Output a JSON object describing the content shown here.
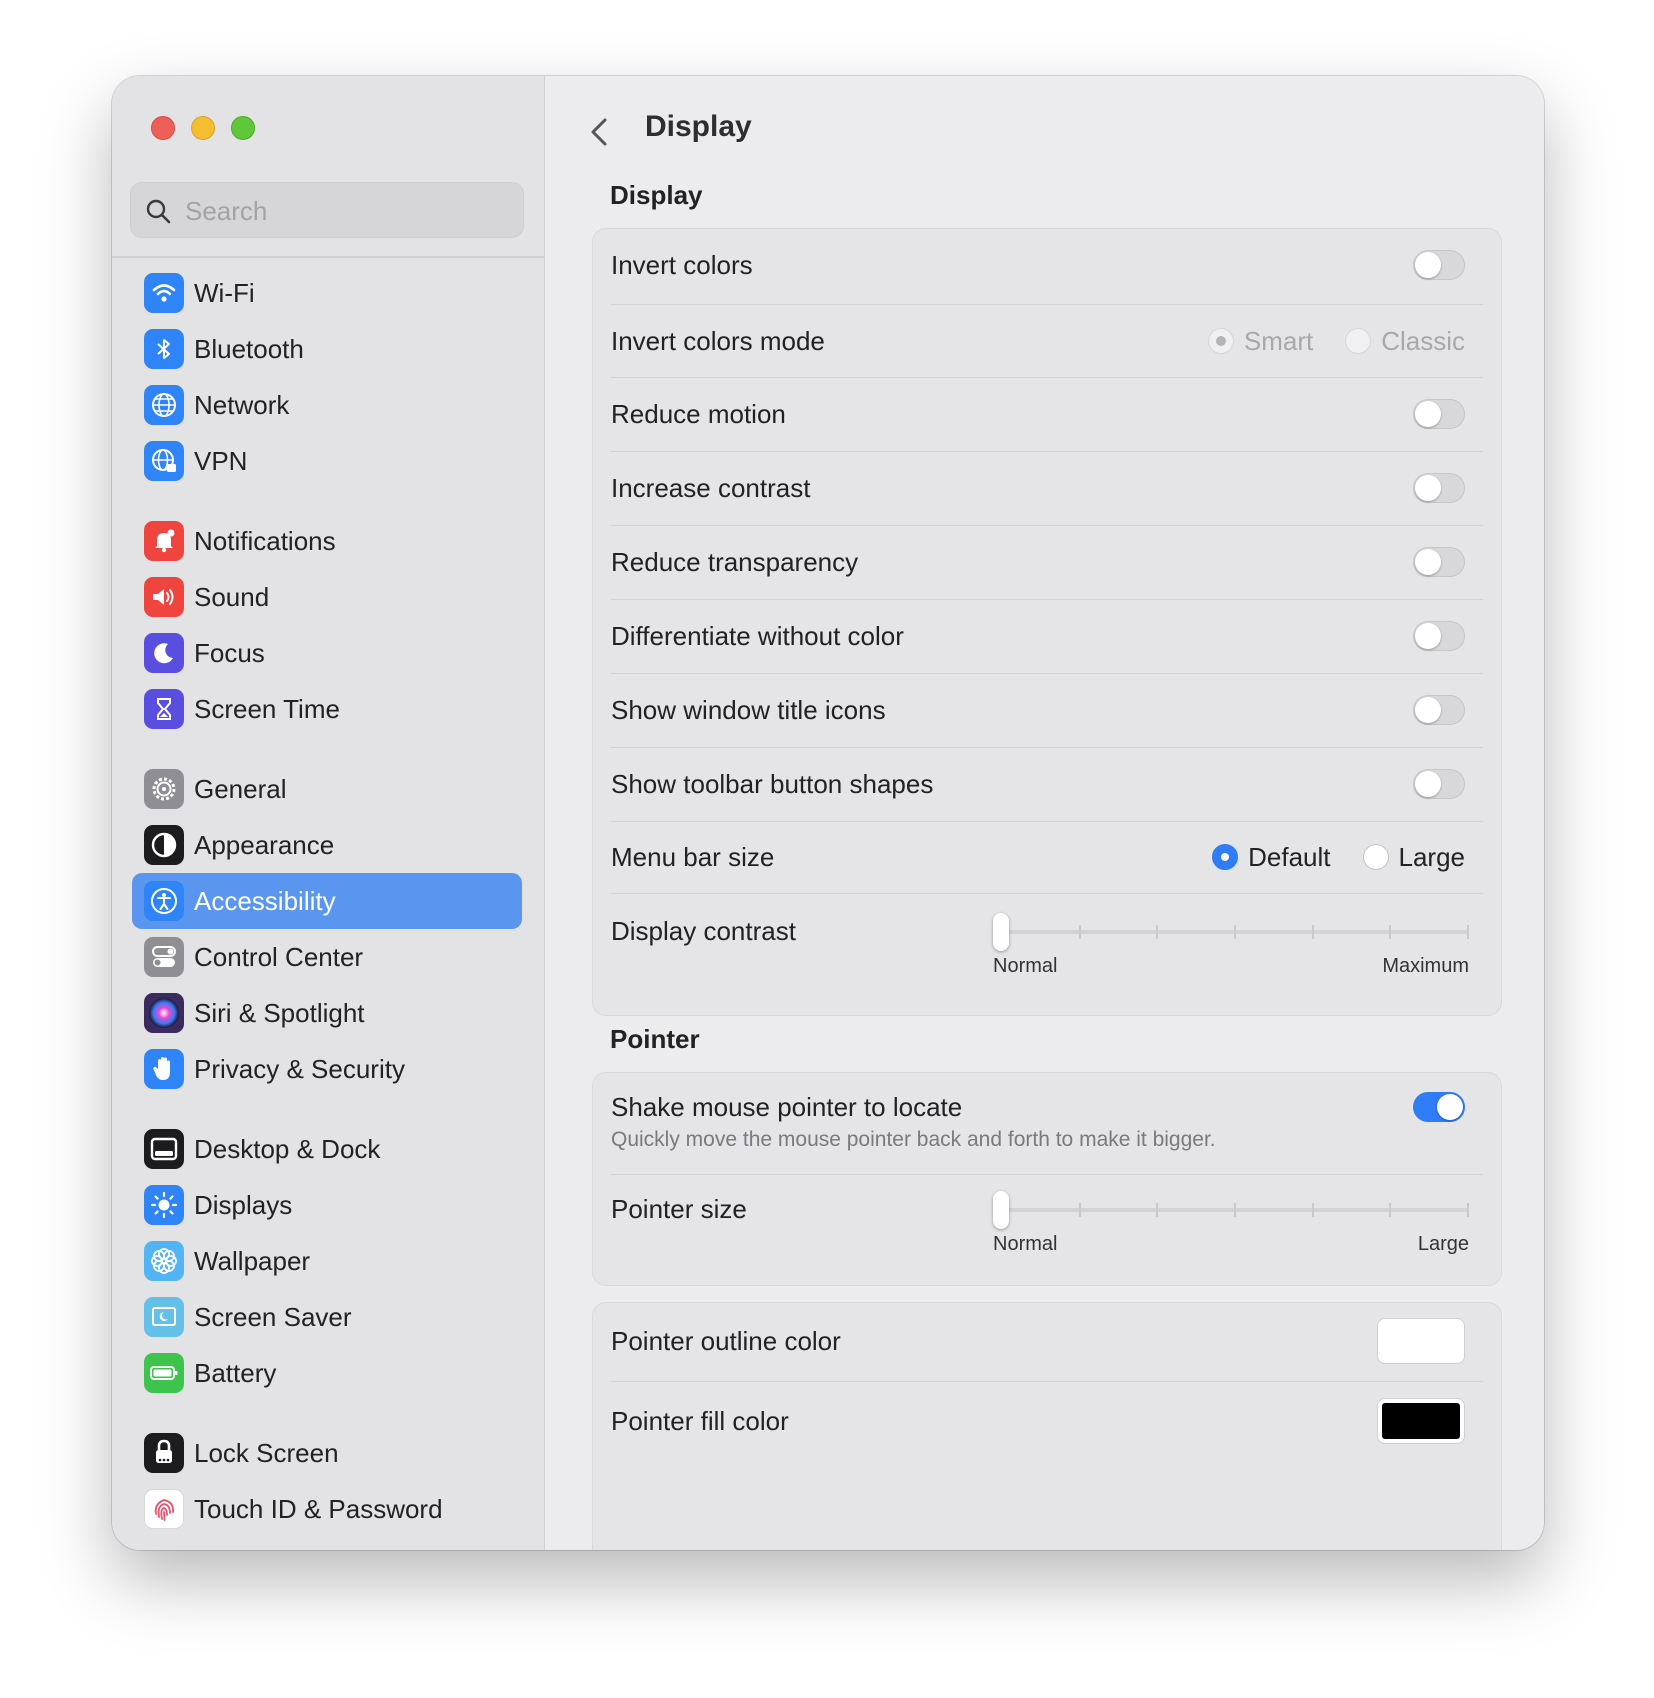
{
  "window": {
    "title": "Display"
  },
  "search": {
    "placeholder": "Search"
  },
  "sidebar": {
    "items": [
      {
        "label": "Wi-Fi",
        "icon": "wifi-icon",
        "color": "#2f84f7"
      },
      {
        "label": "Bluetooth",
        "icon": "bluetooth-icon",
        "color": "#2f84f7"
      },
      {
        "label": "Network",
        "icon": "globe-icon",
        "color": "#2f84f7"
      },
      {
        "label": "VPN",
        "icon": "vpn-globe-icon",
        "color": "#2f84f7"
      },
      {
        "label": "Notifications",
        "icon": "bell-icon",
        "color": "#f0453e"
      },
      {
        "label": "Sound",
        "icon": "speaker-icon",
        "color": "#f0453e"
      },
      {
        "label": "Focus",
        "icon": "moon-icon",
        "color": "#5a4ee0"
      },
      {
        "label": "Screen Time",
        "icon": "hourglass-icon",
        "color": "#5a4ee0"
      },
      {
        "label": "General",
        "icon": "gear-icon",
        "color": "#8e8e93"
      },
      {
        "label": "Appearance",
        "icon": "appearance-icon",
        "color": "#1c1c1e"
      },
      {
        "label": "Accessibility",
        "icon": "accessibility-icon",
        "color": "#2f84f7",
        "selected": true
      },
      {
        "label": "Control Center",
        "icon": "switches-icon",
        "color": "#8e8e93"
      },
      {
        "label": "Siri & Spotlight",
        "icon": "siri-icon",
        "color": "#3a2a5e"
      },
      {
        "label": "Privacy & Security",
        "icon": "hand-icon",
        "color": "#2f84f7"
      },
      {
        "label": "Desktop & Dock",
        "icon": "dock-icon",
        "color": "#1c1c1e"
      },
      {
        "label": "Displays",
        "icon": "sun-icon",
        "color": "#2f84f7"
      },
      {
        "label": "Wallpaper",
        "icon": "flower-icon",
        "color": "#52b4f5"
      },
      {
        "label": "Screen Saver",
        "icon": "screensaver-icon",
        "color": "#64c0e8"
      },
      {
        "label": "Battery",
        "icon": "battery-icon",
        "color": "#3ec44c"
      },
      {
        "label": "Lock Screen",
        "icon": "lock-icon",
        "color": "#1c1c1e"
      },
      {
        "label": "Touch ID & Password",
        "icon": "fingerprint-icon",
        "color": "#ffffff"
      }
    ]
  },
  "display_section": {
    "title": "Display",
    "invert_colors": {
      "label": "Invert colors",
      "on": false
    },
    "invert_mode": {
      "label": "Invert colors mode",
      "options": [
        "Smart",
        "Classic"
      ],
      "selected": "Smart",
      "disabled": true
    },
    "reduce_motion": {
      "label": "Reduce motion",
      "on": false
    },
    "increase_contrast": {
      "label": "Increase contrast",
      "on": false
    },
    "reduce_transparency": {
      "label": "Reduce transparency",
      "on": false
    },
    "differentiate": {
      "label": "Differentiate without color",
      "on": false
    },
    "title_icons": {
      "label": "Show window title icons",
      "on": false
    },
    "toolbar_shapes": {
      "label": "Show toolbar button shapes",
      "on": false
    },
    "menu_bar_size": {
      "label": "Menu bar size",
      "options": [
        "Default",
        "Large"
      ],
      "selected": "Default"
    },
    "display_contrast": {
      "label": "Display contrast",
      "min_label": "Normal",
      "max_label": "Maximum",
      "value": 0,
      "ticks": 7
    }
  },
  "pointer_section": {
    "title": "Pointer",
    "shake": {
      "label": "Shake mouse pointer to locate",
      "description": "Quickly move the mouse pointer back and forth to make it bigger.",
      "on": true
    },
    "pointer_size": {
      "label": "Pointer size",
      "min_label": "Normal",
      "max_label": "Large",
      "value": 0,
      "ticks": 7
    },
    "outline_color": {
      "label": "Pointer outline color",
      "color": "#ffffff"
    },
    "fill_color": {
      "label": "Pointer fill color",
      "color": "#000000"
    }
  }
}
